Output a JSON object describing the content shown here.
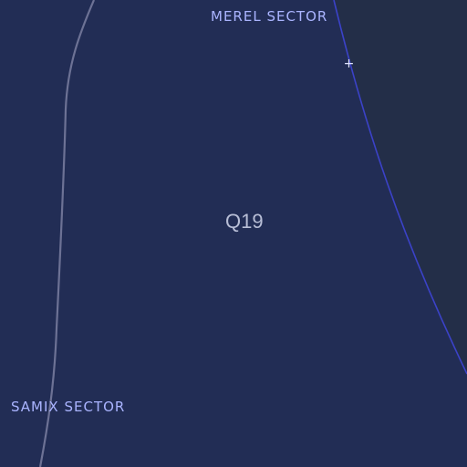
{
  "map": {
    "background_color": "#222d55",
    "neighbor_region_color": "#232e48",
    "boundary_color": "#3b42c8",
    "route_color": "#6d7295"
  },
  "sectors": [
    {
      "name": "MEREL SECTOR"
    },
    {
      "name": "SAMIX SECTOR"
    }
  ],
  "grid_cell": {
    "label": "Q19"
  },
  "marker": {
    "icon": "crosshair-icon",
    "glyph": "+"
  }
}
